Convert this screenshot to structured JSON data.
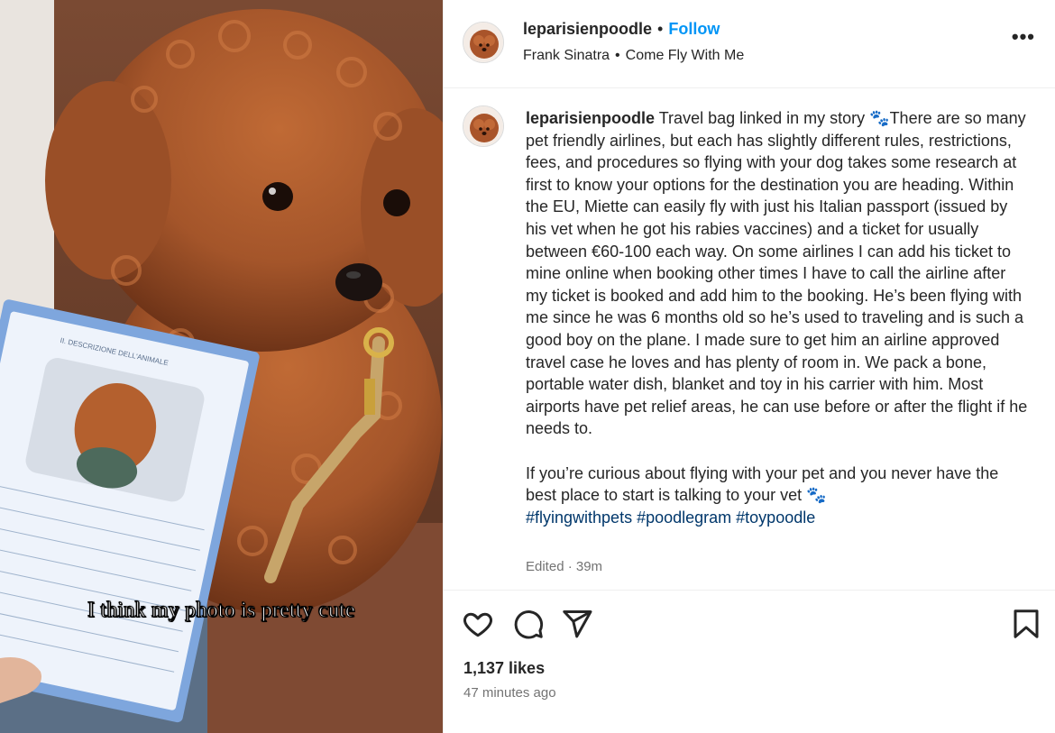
{
  "post": {
    "username": "leparisienpoodle",
    "follow_label": "Follow",
    "separator": "•",
    "music": {
      "artist": "Frank Sinatra",
      "song": "Come Fly With Me"
    },
    "more_label": "•••"
  },
  "media": {
    "overlay_caption": "I think my photo is pretty cute",
    "passport_header": "II. DESCRIZIONE DELL'ANIMALE"
  },
  "caption": {
    "username": "leparisienpoodle",
    "paragraph1": "Travel bag linked in my story 🐾There are so many pet friendly airlines, but each has slightly different rules, restrictions, fees, and procedures so flying with your dog takes some research at first to know your options for the destination you are heading. Within the EU, Miette can easily fly with just his Italian passport (issued by his vet when he got his rabies vaccines) and a ticket for usually between €60-100 each way. On some airlines I can add his ticket to mine online when booking other times I have to call the airline after my ticket is booked and add him to the booking. He’s been flying with me since he was 6 months old so he’s used to traveling and is such a good boy on the plane. I made sure to get him an airline approved travel case he loves and has plenty of room in. We pack a bone, portable water dish, blanket and toy in his carrier with him. Most airports have pet relief areas, he can use before or after the flight if he needs to.",
    "paragraph2": "If you’re curious about flying with your pet and you never have the best place to start is talking to your vet 🐾",
    "hashtags": [
      "#flyingwithpets",
      "#poodlegram",
      "#toypoodle"
    ],
    "edited": "Edited · 39m"
  },
  "actions": {
    "icons": [
      "heart-icon",
      "comment-icon",
      "share-icon",
      "bookmark-icon"
    ],
    "likes": "1,137 likes",
    "time_ago": "47 minutes ago"
  },
  "colors": {
    "link": "#0095f6",
    "hashtag": "#00376b",
    "muted": "#737373",
    "text": "#262626"
  }
}
